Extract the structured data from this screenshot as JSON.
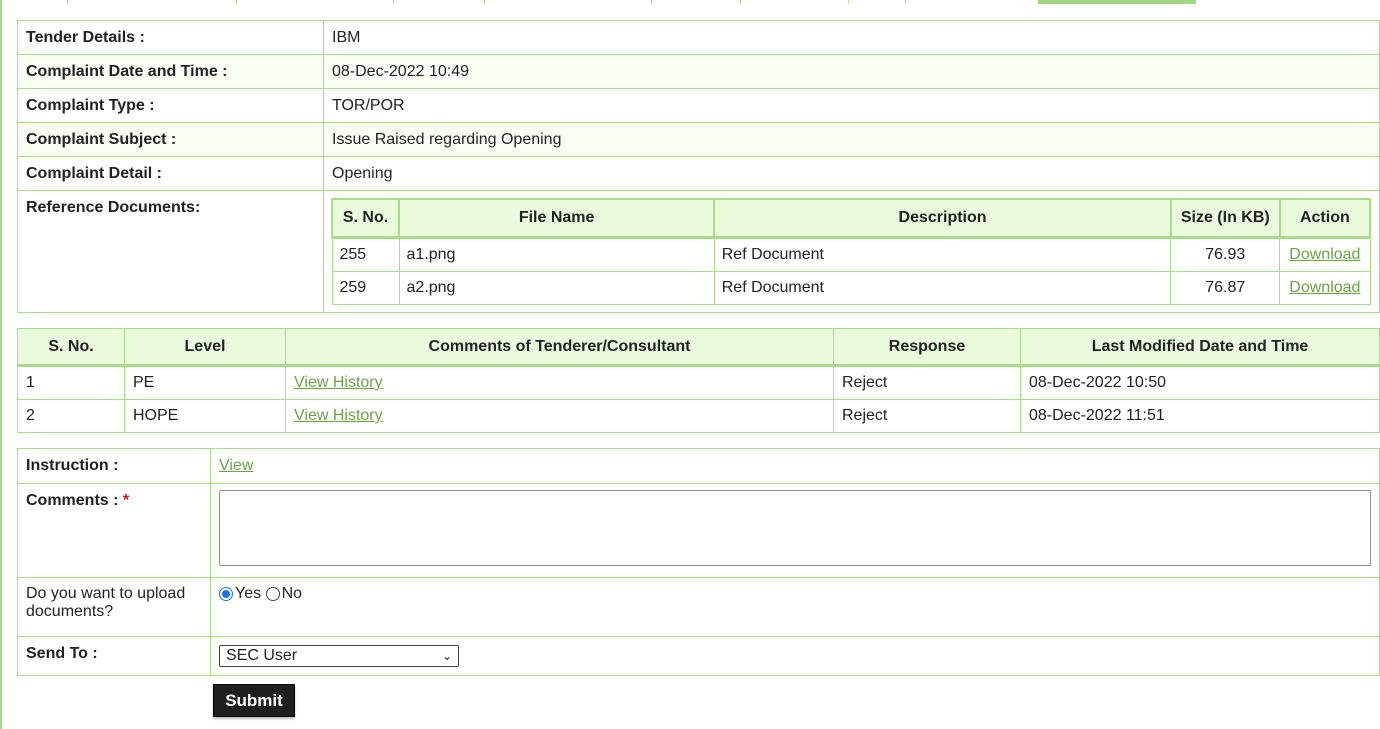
{
  "details": {
    "rows": [
      {
        "label": "Tender Details :",
        "value": "IBM"
      },
      {
        "label": "Complaint Date and Time :",
        "value": "08-Dec-2022 10:49"
      },
      {
        "label": "Complaint Type :",
        "value": "TOR/POR"
      },
      {
        "label": "Complaint Subject :",
        "value": "Issue Raised regarding Opening"
      },
      {
        "label": "Complaint Detail :",
        "value": "Opening"
      }
    ],
    "ref_label": "Reference Documents:"
  },
  "ref_docs": {
    "headers": [
      "S. No.",
      "File Name",
      "Description",
      "Size (In KB)",
      "Action"
    ],
    "rows": [
      {
        "sno": "255",
        "file": "a1.png",
        "desc": "Ref Document",
        "size": "76.93",
        "action": "Download"
      },
      {
        "sno": "259",
        "file": "a2.png",
        "desc": "Ref Document",
        "size": "76.87",
        "action": "Download"
      }
    ]
  },
  "levels": {
    "headers": [
      "S. No.",
      "Level",
      "Comments of Tenderer/Consultant",
      "Response",
      "Last Modified Date and Time"
    ],
    "rows": [
      {
        "sno": "1",
        "level": "PE",
        "comments": "View History",
        "response": "Reject",
        "modified": "08-Dec-2022 10:50"
      },
      {
        "sno": "2",
        "level": "HOPE",
        "comments": "View History",
        "response": "Reject",
        "modified": "08-Dec-2022 11:51"
      }
    ]
  },
  "form": {
    "instruction_label": "Instruction :",
    "instruction_link": "View",
    "comments_label": "Comments :",
    "required_mark": "*",
    "comments_value": "",
    "upload_label": "Do you want to upload documents?",
    "yes_label": "Yes",
    "no_label": "No",
    "upload_selected": "Yes",
    "send_to_label": "Send To :",
    "send_to_value": "SEC User",
    "submit_label": "Submit"
  },
  "colors": {
    "border": "#a6dc8a",
    "header_bg": "#e9fbdc",
    "link": "#6ba34a",
    "required": "#d21414",
    "submit_bg": "#1e1e1e"
  }
}
